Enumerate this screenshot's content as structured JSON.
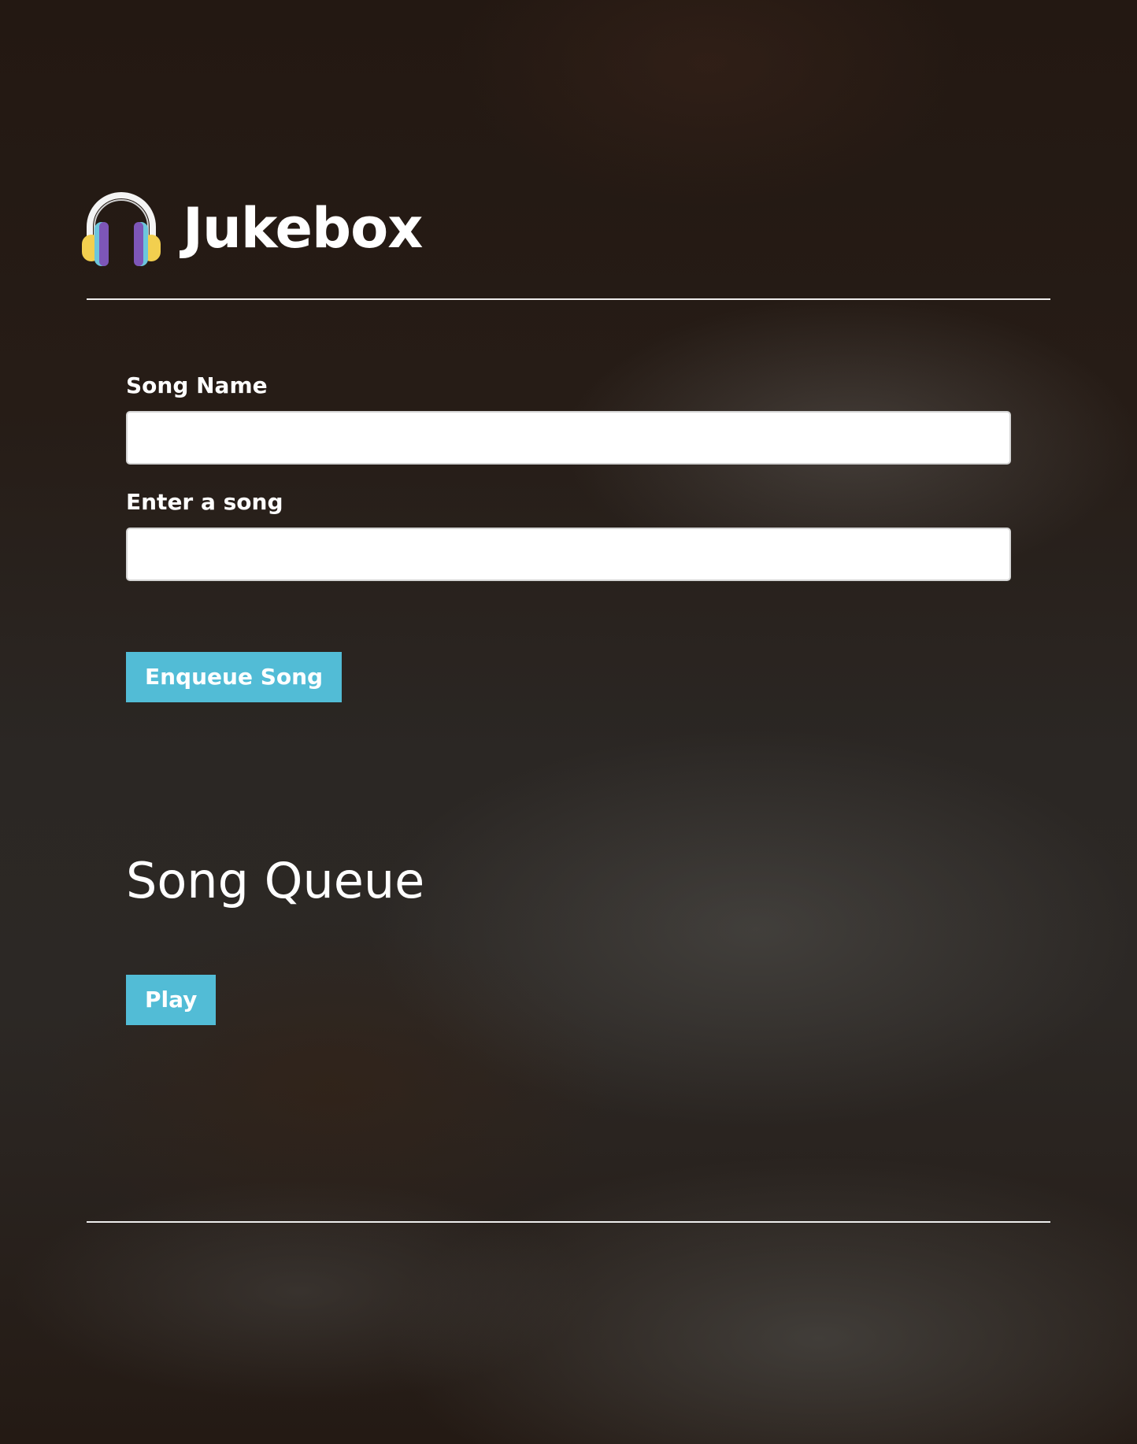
{
  "header": {
    "logo_icon": "headphones-icon",
    "title": "Jukebox"
  },
  "form": {
    "song_name_label": "Song Name",
    "song_name_value": "",
    "enter_song_label": "Enter a song",
    "enter_song_value": "",
    "enqueue_button_label": "Enqueue Song"
  },
  "queue": {
    "title": "Song Queue",
    "play_button_label": "Play"
  },
  "colors": {
    "accent_button": "#52bcd6",
    "text": "#ffffff",
    "input_background": "#ffffff"
  }
}
